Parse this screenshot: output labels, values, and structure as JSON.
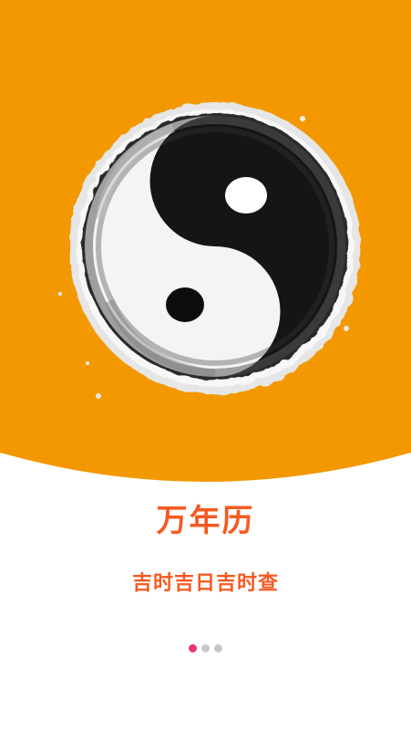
{
  "app": {
    "title": "万年历",
    "subtitle": "吉时吉日吉时查"
  },
  "hero": {
    "background_color": "#f39800",
    "logo_icon": "yin-yang-icon"
  },
  "colors": {
    "accent": "#f55a22",
    "dot_active": "#e8386a",
    "dot_inactive": "#c8c8c8"
  },
  "pager": {
    "total": 3,
    "active_index": 0
  }
}
